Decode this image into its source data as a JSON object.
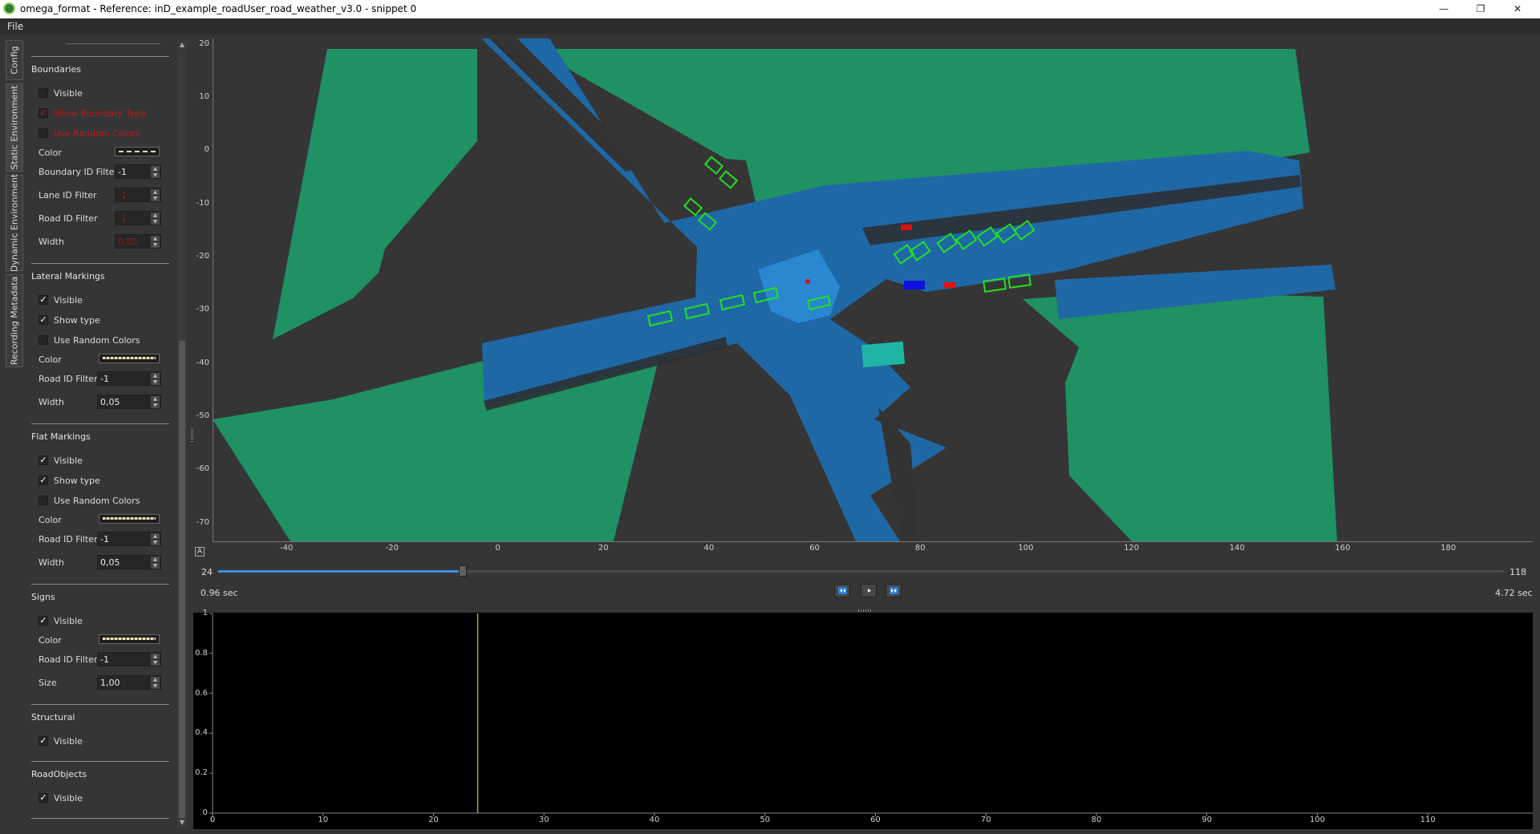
{
  "window": {
    "title": "omega_format - Reference: inD_example_roadUser_road_weather_v3.0 - snippet 0",
    "minimize_label": "—",
    "maximize_label": "❐",
    "close_label": "✕"
  },
  "menu": {
    "file_label": "File"
  },
  "tabs": [
    {
      "label": "Config"
    },
    {
      "label": "Static Environment"
    },
    {
      "label": "Dynamic Environment"
    },
    {
      "label": "Recording Metadata"
    }
  ],
  "sidebar": {
    "boundaries": {
      "title": "Boundaries",
      "visible_label": "Visible",
      "visible_checked": false,
      "show_boundary_type_label": "Show Boundary Type",
      "show_boundary_type_checked": true,
      "use_random_colors_label": "Use Random Colors",
      "use_random_colors_checked": false,
      "color_label": "Color",
      "boundary_id_filter_label": "Boundary ID Filter",
      "boundary_id_filter_value": "-1",
      "lane_id_filter_label": "Lane ID Filter",
      "lane_id_filter_value": "-1",
      "road_id_filter_label": "Road ID Filter",
      "road_id_filter_value": "-1",
      "width_label": "Width",
      "width_value": "0,05"
    },
    "lateral_markings": {
      "title": "Lateral Markings",
      "visible_label": "Visible",
      "visible_checked": true,
      "show_type_label": "Show type",
      "show_type_checked": true,
      "use_random_colors_label": "Use Random Colors",
      "use_random_colors_checked": false,
      "color_label": "Color",
      "road_id_filter_label": "Road ID Filter",
      "road_id_filter_value": "-1",
      "width_label": "Width",
      "width_value": "0,05"
    },
    "flat_markings": {
      "title": "Flat Markings",
      "visible_label": "Visible",
      "visible_checked": true,
      "show_type_label": "Show type",
      "show_type_checked": true,
      "use_random_colors_label": "Use Random Colors",
      "use_random_colors_checked": false,
      "color_label": "Color",
      "road_id_filter_label": "Road ID Filter",
      "road_id_filter_value": "-1",
      "width_label": "Width",
      "width_value": "0,05"
    },
    "signs": {
      "title": "Signs",
      "visible_label": "Visible",
      "visible_checked": true,
      "color_label": "Color",
      "road_id_filter_label": "Road ID Filter",
      "road_id_filter_value": "-1",
      "size_label": "Size",
      "size_value": "1,00"
    },
    "structural": {
      "title": "Structural",
      "visible_label": "Visible",
      "visible_checked": true
    },
    "road_objects": {
      "title": "RoadObjects",
      "visible_label": "Visible",
      "visible_checked": true
    }
  },
  "map": {
    "x_ticks": [
      "-40",
      "-20",
      "0",
      "20",
      "40",
      "60",
      "80",
      "100",
      "120",
      "140",
      "160",
      "180"
    ],
    "y_ticks": [
      "20",
      "10",
      "0",
      "-10",
      "-20",
      "-30",
      "-40",
      "-50",
      "-60",
      "-70"
    ],
    "x_range": [
      -54,
      196
    ],
    "y_range": [
      21,
      -73.5
    ],
    "background_color": "#353535",
    "grass_color": "#1f9163",
    "road_color": "#1f68a6",
    "vehicle_color": "#22e022",
    "autoscale_label": "A"
  },
  "timeline": {
    "min_label": "24",
    "max_label": "118",
    "current_fraction": 0.19,
    "current_time": "0.96 sec",
    "end_time": "4.72 sec",
    "accent_color": "#3d8ee3"
  },
  "plot": {
    "x_ticks": [
      "0",
      "10",
      "20",
      "30",
      "40",
      "50",
      "60",
      "70",
      "80",
      "90",
      "100",
      "110"
    ],
    "y_ticks": [
      "1",
      "0.8",
      "0.6",
      "0.4",
      "0.2",
      "0"
    ],
    "x_range": [
      0,
      119.5
    ],
    "y_range": [
      0,
      1
    ],
    "marker_x": 24,
    "marker_color": "#a8a83a",
    "background_color": "#000000"
  }
}
